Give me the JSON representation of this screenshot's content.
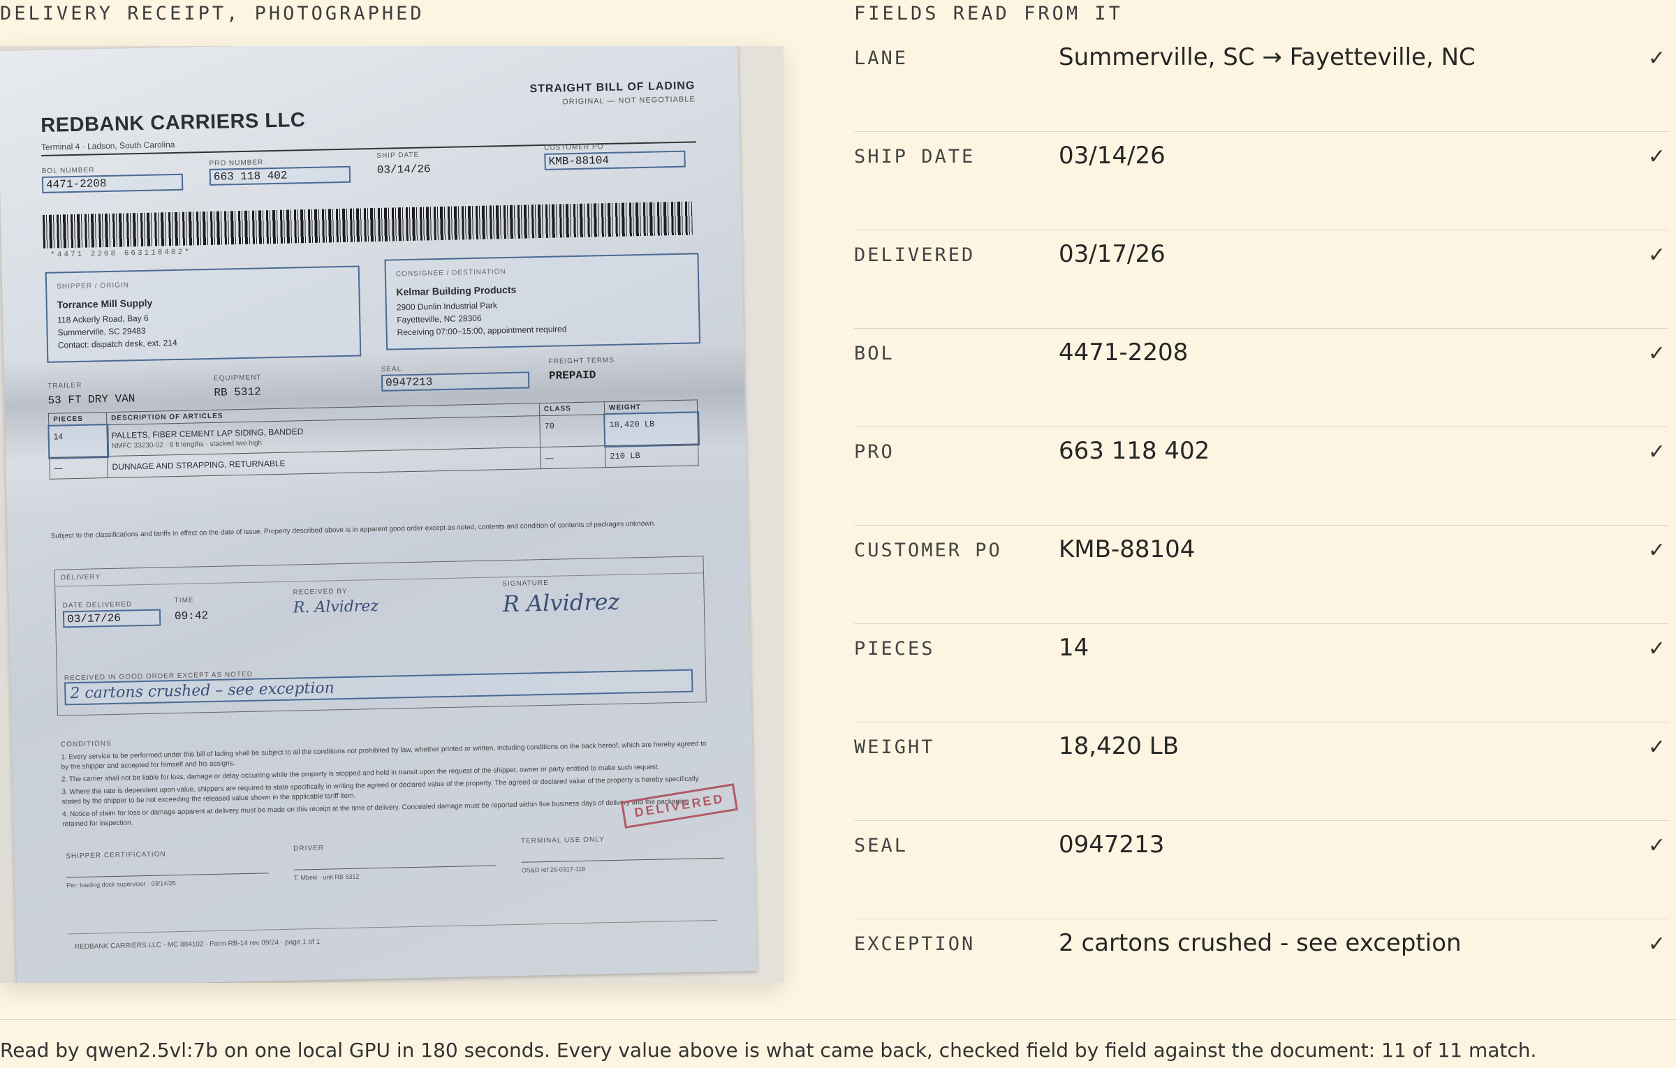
{
  "left_caption": "DELIVERY RECEIPT, PHOTOGRAPHED",
  "right_caption": "FIELDS READ FROM IT",
  "receipt": {
    "carrier_name": "REDBANK CARRIERS LLC",
    "carrier_sub": "Terminal 4 · Ladson, South Carolina",
    "doc_title": "STRAIGHT BILL OF LADING",
    "doc_sub": "ORIGINAL — NOT NEGOTIABLE",
    "bol_label": "BOL NUMBER",
    "bol_value": "4471-2208",
    "pro_label": "PRO NUMBER",
    "pro_value": "663 118 402",
    "ship_label": "SHIP DATE",
    "ship_value": "03/14/26",
    "po_label": "CUSTOMER PO",
    "po_value": "KMB-88104",
    "barcode_text": "*4471 2208 663118402*",
    "shipper_label": "SHIPPER / ORIGIN",
    "shipper_name": "Torrance Mill Supply",
    "shipper_lines": [
      "118 Ackerly Road, Bay 6",
      "Summerville, SC 29483",
      "Contact: dispatch desk, ext. 214"
    ],
    "consignee_label": "CONSIGNEE / DESTINATION",
    "consignee_name": "Kelmar Building Products",
    "consignee_lines": [
      "2900 Dunlin Industrial Park",
      "Fayetteville, NC 28306",
      "Receiving 07:00–15:00, appointment required"
    ],
    "trailer_label": "TRAILER",
    "trailer_value": "53 FT DRY VAN",
    "equip_label": "EQUIPMENT",
    "equip_value": "RB 5312",
    "seal_label": "SEAL",
    "seal_value": "0947213",
    "terms_label": "FREIGHT TERMS",
    "terms_value": "PREPAID",
    "table_headers": [
      "PIECES",
      "DESCRIPTION OF ARTICLES",
      "CLASS",
      "WEIGHT"
    ],
    "row1": {
      "pieces": "14",
      "desc": "PALLETS, FIBER CEMENT LAP SIDING, BANDED",
      "desc_sub": "NMFC 33230-02 · 8 ft lengths · stacked two high",
      "class": "70",
      "weight": "18,420 LB"
    },
    "row2": {
      "pieces": "—",
      "desc": "DUNNAGE AND STRAPPING, RETURNABLE",
      "class": "—",
      "weight": "210 LB"
    },
    "subject_text": "Subject to the classifications and tariffs in effect on the date of issue. Property described above is in apparent good order except as noted, contents and condition of contents of packages unknown.",
    "delivery_label": "DELIVERY",
    "date_del_label": "DATE DELIVERED",
    "date_del_value": "03/17/26",
    "time_label": "TIME",
    "time_value": "09:42",
    "recv_label": "RECEIVED BY",
    "recv_value": "R. Alvidrez",
    "sig_label": "SIGNATURE",
    "sig_value": "R Alvidrez",
    "exception_label": "RECEIVED IN GOOD ORDER EXCEPT AS NOTED",
    "exception_value": "2 cartons crushed – see exception",
    "conditions_label": "CONDITIONS",
    "conditions": [
      "1. Every service to be performed under this bill of lading shall be subject to all the conditions not prohibited by law, whether printed or written, including conditions on the back hereof, which are hereby agreed to by the shipper and accepted for himself and his assigns.",
      "2. The carrier shall not be liable for loss, damage or delay occurring while the property is stopped and held in transit upon the request of the shipper, owner or party entitled to make such request.",
      "3. Where the rate is dependent upon value, shippers are required to state specifically in writing the agreed or declared value of the property. The agreed or declared value of the property is hereby specifically stated by the shipper to be not exceeding the released value shown in the applicable tariff item.",
      "4. Notice of claim for loss or damage apparent at delivery must be made on this receipt at the time of delivery. Concealed damage must be reported within five business days of delivery and the packaging retained for inspection."
    ],
    "ship_cert_label": "SHIPPER CERTIFICATION",
    "ship_cert_sub": "Per: loading dock supervisor · 03/14/26",
    "driver_label": "DRIVER",
    "driver_sub": "T. Mbeki · unit RB 5312",
    "terminal_label": "TERMINAL USE ONLY",
    "terminal_sub": "OS&D ref 26-0317-118",
    "stamp": "DELIVERED",
    "form_footer": "REDBANK CARRIERS LLC · MC 884102 · Form RB-14 rev 09/24 · page 1 of 1"
  },
  "fields": [
    {
      "name": "LANE",
      "value": "Summerville, SC → Fayetteville, NC",
      "check": "✓"
    },
    {
      "name": "SHIP DATE",
      "value": "03/14/26",
      "check": "✓"
    },
    {
      "name": "DELIVERED",
      "value": "03/17/26",
      "check": "✓"
    },
    {
      "name": "BOL",
      "value": "4471-2208",
      "check": "✓"
    },
    {
      "name": "PRO",
      "value": "663 118 402",
      "check": "✓"
    },
    {
      "name": "CUSTOMER PO",
      "value": "KMB-88104",
      "check": "✓"
    },
    {
      "name": "PIECES",
      "value": "14",
      "check": "✓"
    },
    {
      "name": "WEIGHT",
      "value": "18,420 LB",
      "check": "✓"
    },
    {
      "name": "SEAL",
      "value": "0947213",
      "check": "✓"
    },
    {
      "name": "EXCEPTION",
      "value": "2 cartons crushed - see exception",
      "check": "✓"
    }
  ],
  "footer": "Read by qwen2.5vl:7b on one local GPU in 180 seconds. Every value above is what came back, checked field by field against the document: 11 of 11 match."
}
